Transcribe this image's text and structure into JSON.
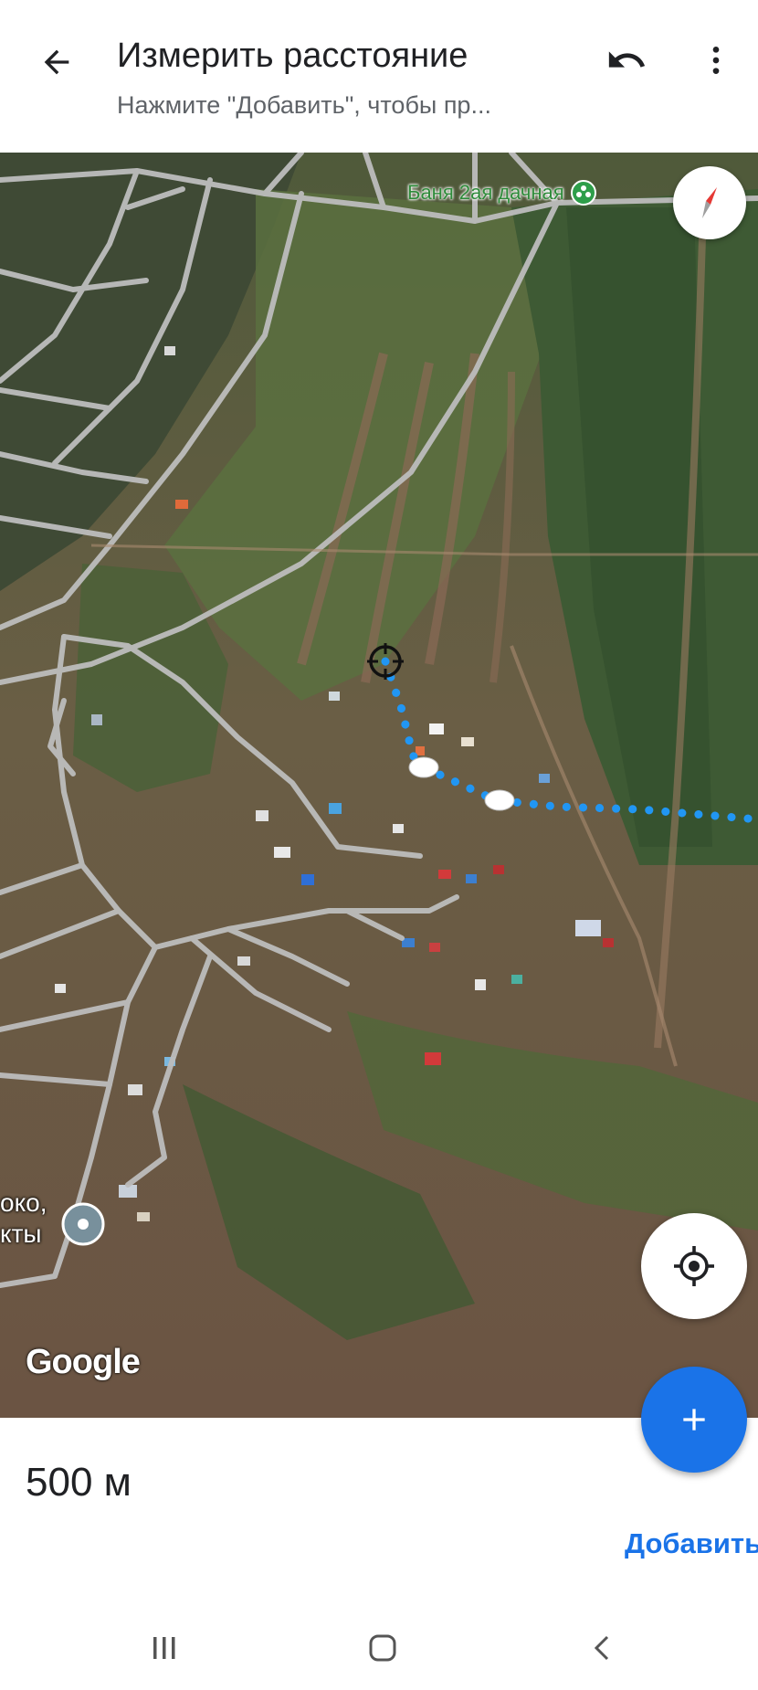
{
  "header": {
    "title": "Измерить расстояние",
    "subtitle": "Нажмите \"Добавить\", чтобы пр...",
    "back_icon": "arrow-back-icon",
    "undo_icon": "undo-icon",
    "more_icon": "more-vert-icon"
  },
  "map": {
    "type": "satellite",
    "poi": {
      "label": "Баня 2ая дачная",
      "icon": "poi-icon"
    },
    "place_label_lines": [
      "око,",
      "кты"
    ],
    "google_logo": "Google",
    "compass_icon": "compass-icon",
    "locate_icon": "my-location-icon",
    "measure_line_color": "#2196f3"
  },
  "bottom": {
    "distance": "500 м",
    "add_button_label": "Добавить",
    "fab_icon": "plus-icon"
  },
  "system_nav": {
    "recents_icon": "recents-icon",
    "home_icon": "home-icon",
    "back_icon": "back-chevron-icon"
  }
}
